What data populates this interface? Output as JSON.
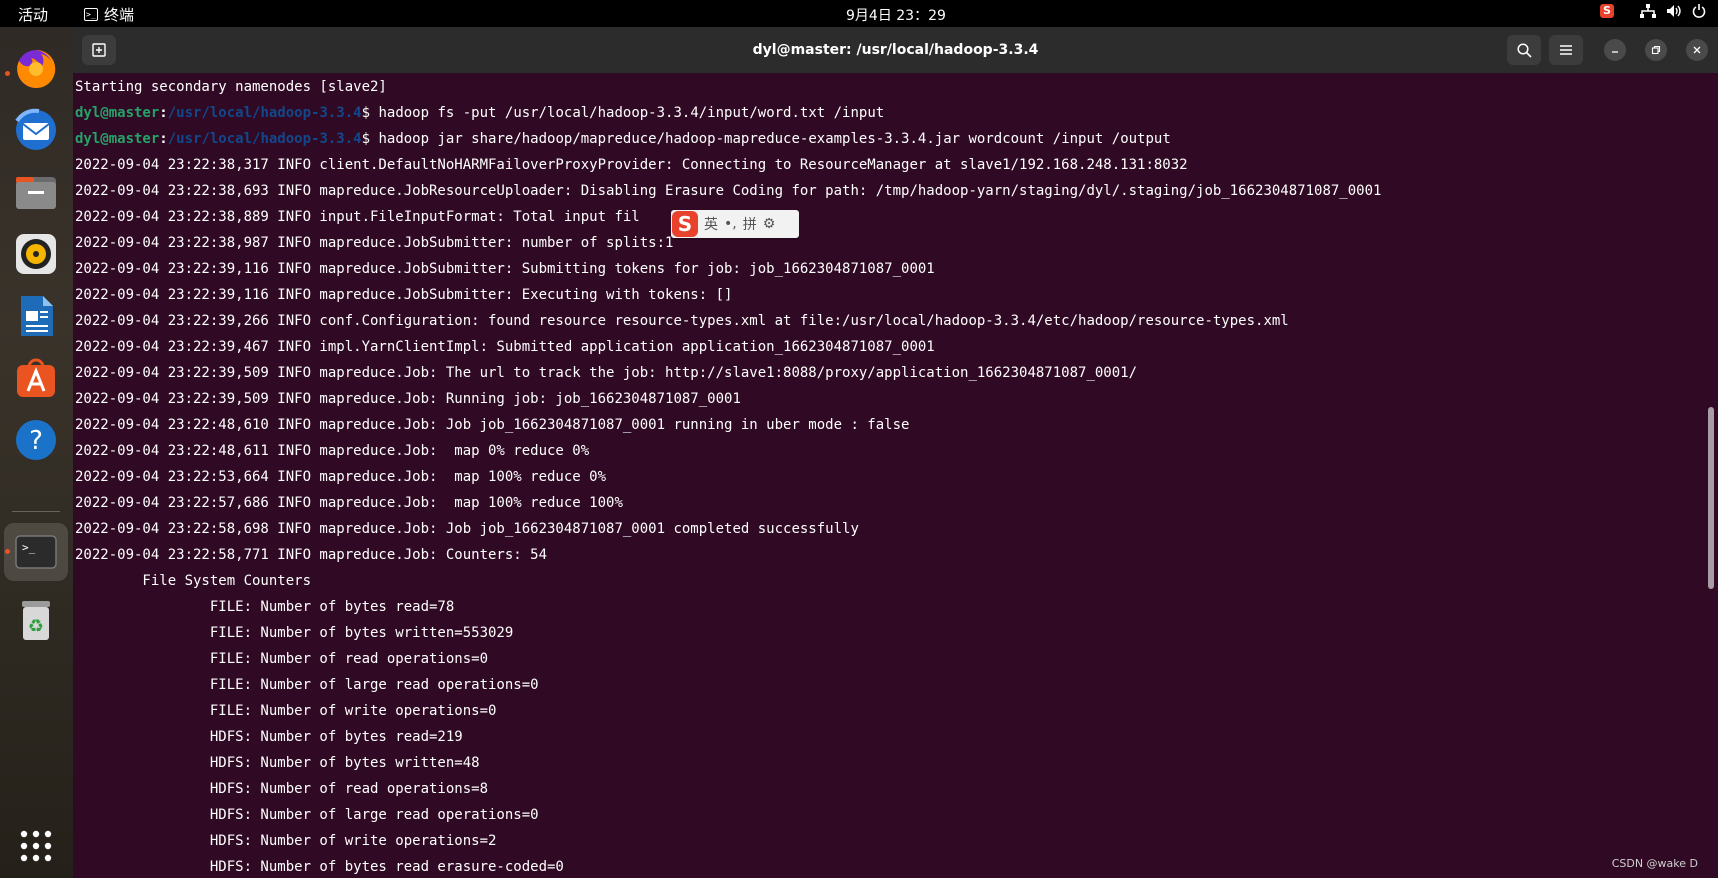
{
  "topbar": {
    "activities": "活动",
    "app_name": "终端",
    "app_icon_glyph": ">_",
    "clock": "9月4日  23：29",
    "ime_tray_glyph": "S"
  },
  "dock": {
    "items": [
      "firefox",
      "thunderbird",
      "files",
      "rhythmbox",
      "libreoffice-writer",
      "software",
      "help",
      "terminal",
      "trash",
      "app-grid"
    ],
    "help_glyph": "?",
    "terminal_glyph": ">_",
    "trash_glyph": "♻"
  },
  "window": {
    "title": "dyl@master: /usr/local/hadoop-3.3.4"
  },
  "terminal": {
    "prompt_user": "dyl@master",
    "prompt_path": "/usr/local/hadoop-3.3.4",
    "line0": "Starting secondary namenodes [slave2]",
    "cmd1": "$ hadoop fs -put /usr/local/hadoop-3.3.4/input/word.txt /input",
    "cmd2": "$ hadoop jar share/hadoop/mapreduce/hadoop-mapreduce-examples-3.3.4.jar wordcount /input /output",
    "l3": "2022-09-04 23:22:38,317 INFO client.DefaultNoHARMFailoverProxyProvider: Connecting to ResourceManager at slave1/192.168.248.131:8032",
    "l4": "2022-09-04 23:22:38,693 INFO mapreduce.JobResourceUploader: Disabling Erasure Coding for path: /tmp/hadoop-yarn/staging/dyl/.staging/job_1662304871087_0001",
    "l5": "2022-09-04 23:22:38,889 INFO input.FileInputFormat: Total input fil             : 1",
    "l6": "2022-09-04 23:22:38,987 INFO mapreduce.JobSubmitter: number of splits:1",
    "l7": "2022-09-04 23:22:39,116 INFO mapreduce.JobSubmitter: Submitting tokens for job: job_1662304871087_0001",
    "l8": "2022-09-04 23:22:39,116 INFO mapreduce.JobSubmitter: Executing with tokens: []",
    "l9": "2022-09-04 23:22:39,266 INFO conf.Configuration: found resource resource-types.xml at file:/usr/local/hadoop-3.3.4/etc/hadoop/resource-types.xml",
    "l10": "2022-09-04 23:22:39,467 INFO impl.YarnClientImpl: Submitted application application_1662304871087_0001",
    "l11": "2022-09-04 23:22:39,509 INFO mapreduce.Job: The url to track the job: http://slave1:8088/proxy/application_1662304871087_0001/",
    "l12": "2022-09-04 23:22:39,509 INFO mapreduce.Job: Running job: job_1662304871087_0001",
    "l13": "2022-09-04 23:22:48,610 INFO mapreduce.Job: Job job_1662304871087_0001 running in uber mode : false",
    "l14": "2022-09-04 23:22:48,611 INFO mapreduce.Job:  map 0% reduce 0%",
    "l15": "2022-09-04 23:22:53,664 INFO mapreduce.Job:  map 100% reduce 0%",
    "l16": "2022-09-04 23:22:57,686 INFO mapreduce.Job:  map 100% reduce 100%",
    "l17": "2022-09-04 23:22:58,698 INFO mapreduce.Job: Job job_1662304871087_0001 completed successfully",
    "l18": "2022-09-04 23:22:58,771 INFO mapreduce.Job: Counters: 54",
    "l19": "        File System Counters",
    "l20": "                FILE: Number of bytes read=78",
    "l21": "                FILE: Number of bytes written=553029",
    "l22": "                FILE: Number of read operations=0",
    "l23": "                FILE: Number of large read operations=0",
    "l24": "                FILE: Number of write operations=0",
    "l25": "                HDFS: Number of bytes read=219",
    "l26": "                HDFS: Number of bytes written=48",
    "l27": "                HDFS: Number of read operations=8",
    "l28": "                HDFS: Number of large read operations=0",
    "l29": "                HDFS: Number of write operations=2",
    "l30": "                HDFS: Number of bytes read erasure-coded=0"
  },
  "ime": {
    "logo": "S",
    "lang": "英",
    "punct": "•,",
    "mode": "拼",
    "settings_glyph": "⚙"
  },
  "watermark": "CSDN @wake D",
  "colors": {
    "terminal_bg": "#300a24",
    "prompt_user": "#26a269",
    "prompt_path": "#12488b",
    "accent": "#e95420"
  }
}
